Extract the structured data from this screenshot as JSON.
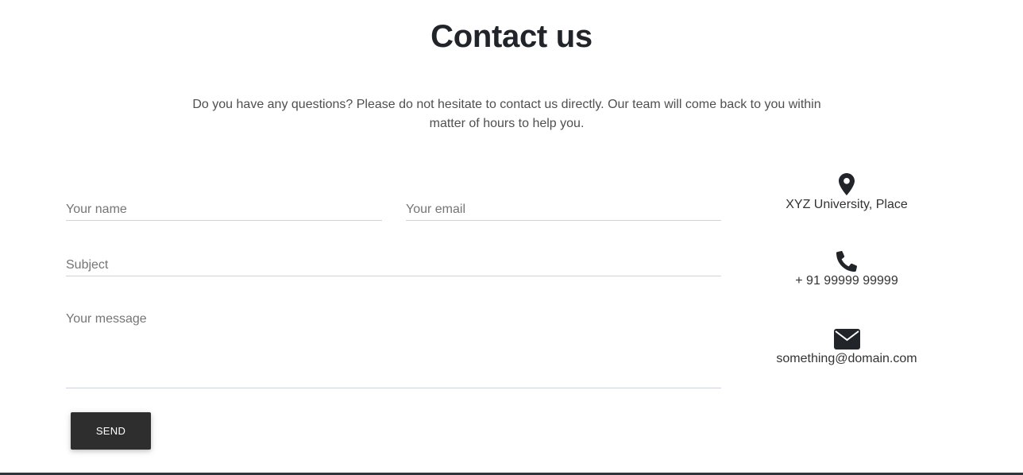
{
  "page": {
    "title": "Contact us",
    "intro": "Do you have any questions? Please do not hesitate to contact us directly. Our team will come back to you within matter of hours to help you."
  },
  "form": {
    "name_placeholder": "Your name",
    "email_placeholder": "Your email",
    "subject_placeholder": "Subject",
    "message_placeholder": "Your message",
    "send_label": "SEND"
  },
  "contact": {
    "address": "XYZ University, Place",
    "phone": "+ 91 99999 99999",
    "email": "something@domain.com"
  },
  "icons": {
    "address": "map-marker-icon",
    "phone": "phone-icon",
    "email": "envelope-icon"
  },
  "colors": {
    "text": "#212529",
    "button_bg": "#2e2e2e",
    "field_border": "#ced4da"
  }
}
